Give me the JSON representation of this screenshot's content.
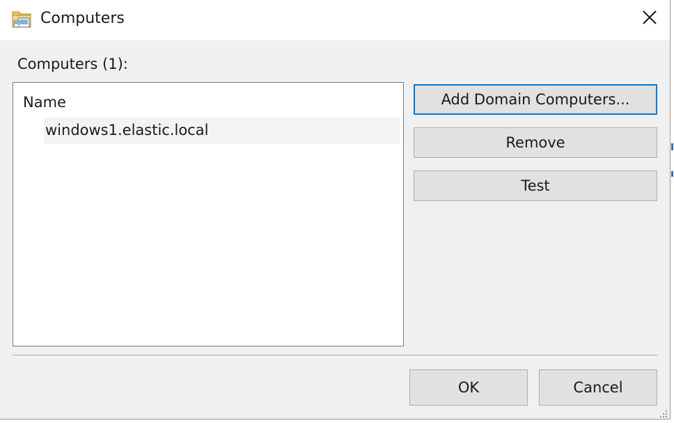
{
  "window": {
    "title": "Computers",
    "icon": "folder-computers-icon"
  },
  "computers": {
    "label": "Computers (1):",
    "column_header": "Name",
    "items": [
      {
        "name": "windows1.elastic.local"
      }
    ]
  },
  "buttons": {
    "add_domain_computers": "Add Domain Computers...",
    "remove": "Remove",
    "test": "Test",
    "ok": "OK",
    "cancel": "Cancel"
  },
  "colors": {
    "accent": "#0078d7",
    "button_face": "#e1e1e1",
    "dialog_bg": "#f0f0f0"
  }
}
